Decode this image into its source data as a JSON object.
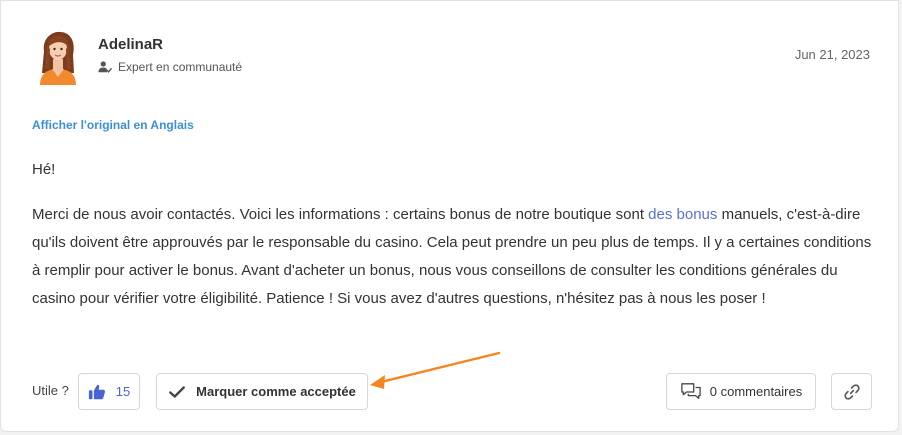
{
  "post": {
    "username": "AdelinaR",
    "role": "Expert en communauté",
    "date": "Jun 21, 2023",
    "translate_link": "Afficher l'original en Anglais",
    "greeting": "Hé!",
    "body_before_link": "Merci de nous avoir contactés. Voici les informations : certains bonus de notre boutique sont ",
    "body_link": "des bonus",
    "body_after_link": " manuels, c'est-à-dire qu'ils doivent être approuvés par le responsable du casino. Cela peut prendre un peu plus de temps. Il y a certaines conditions à remplir pour activer le bonus. Avant d'acheter un bonus, nous vous conseillons de consulter les conditions générales du casino pour vérifier votre éligibilité. Patience ! Si vous avez d'autres questions, n'hésitez pas à nous les poser !"
  },
  "actions": {
    "useful_label": "Utile ?",
    "like_count": "15",
    "accept_label": "Marquer comme acceptée",
    "comments_label": "0 commentaires"
  },
  "colors": {
    "accent": "#4a63d1",
    "link": "#3b8fd9",
    "annotation_arrow": "#f5861f"
  },
  "icons": {
    "role": "user-check-icon",
    "like": "thumbs-up-icon",
    "accept": "checkmark-icon",
    "comments": "comments-icon",
    "link": "link-icon"
  }
}
